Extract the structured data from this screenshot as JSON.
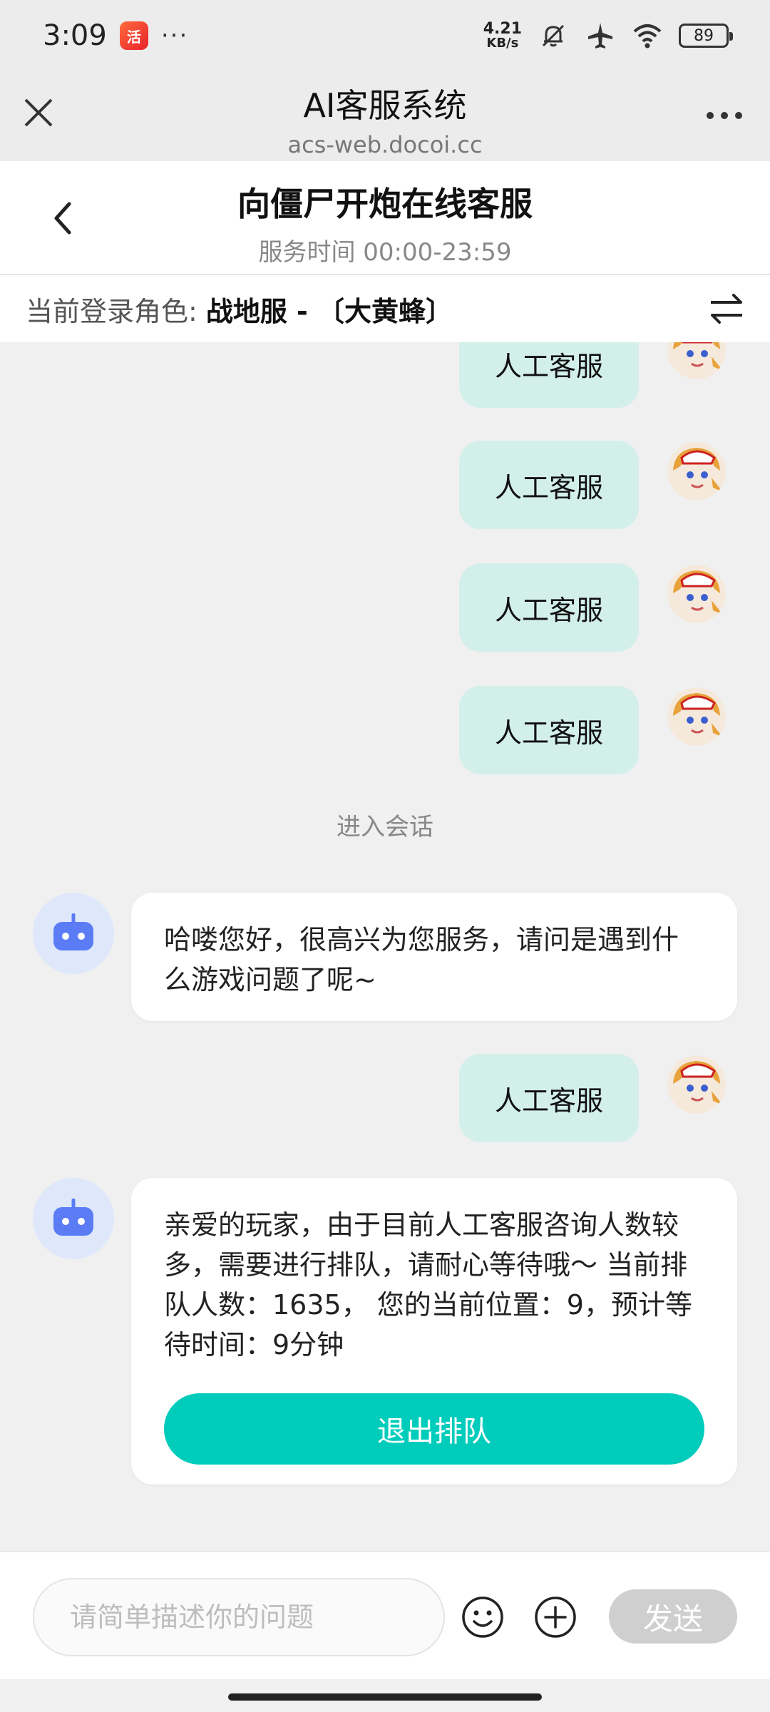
{
  "status_bar": {
    "time": "3:09",
    "app_badge_label": "活",
    "more_dots": "···",
    "net_speed_value": "4.21",
    "net_speed_unit": "KB/s",
    "battery": "89"
  },
  "browser": {
    "title": "AI客服系统",
    "url": "acs-web.docoi.cc"
  },
  "chat_header": {
    "title": "向僵尸开炮在线客服",
    "service_hours": "服务时间 00:00-23:59"
  },
  "role_bar": {
    "label": "当前登录角色:",
    "value": "战地服 - 〔大黄蜂〕"
  },
  "messages": {
    "user_msg_1": "人工客服",
    "user_msg_2": "人工客服",
    "user_msg_3": "人工客服",
    "user_msg_4": "人工客服",
    "system_note": "进入会话",
    "bot_msg_1": "哈喽您好，很高兴为您服务，请问是遇到什么游戏问题了呢~",
    "user_msg_5": "人工客服",
    "bot_msg_2": "亲爱的玩家，由于目前人工客服咨询人数较多，需要进行排队，请耐心等待哦～ 当前排队人数：1635， 您的当前位置：9，预计等待时间：9分钟",
    "exit_queue_label": "退出排队"
  },
  "input_bar": {
    "placeholder": "请简单描述你的问题",
    "value": "",
    "send_label": "发送"
  },
  "colors": {
    "accent": "#00ccbb",
    "user_bubble": "#d3efe9",
    "bot_avatar_bg": "#dfe7fb",
    "bot_icon": "#5b7cf5"
  }
}
